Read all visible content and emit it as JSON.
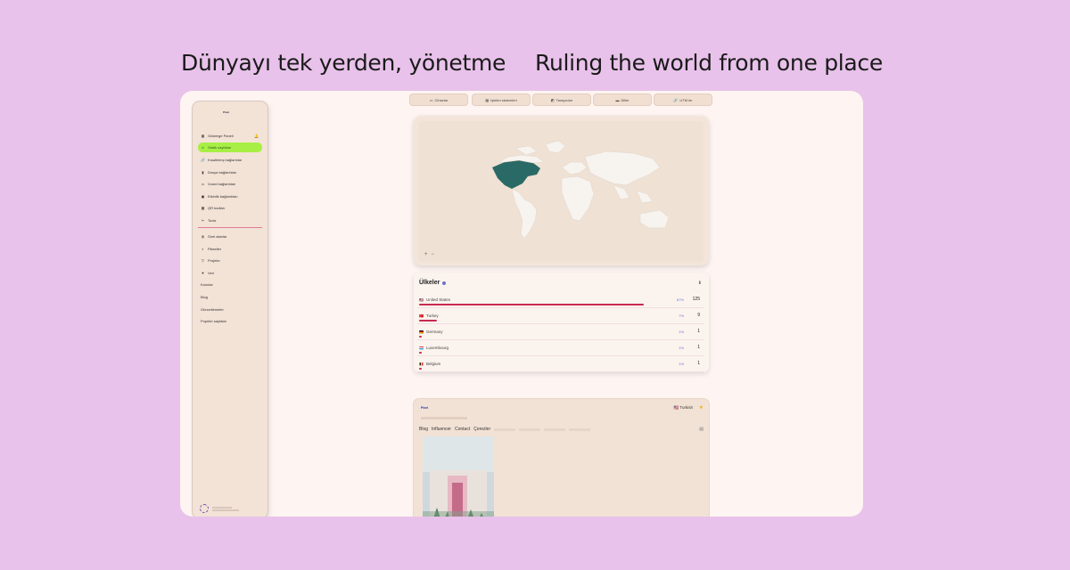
{
  "headlines": {
    "left": "Dünyayı tek yerden, yönetme",
    "right": "Ruling the world from one place"
  },
  "sidebar": {
    "logo": "Pixel",
    "items": [
      {
        "label": "Gösterge Paneli",
        "icon": "dashboard-icon"
      },
      {
        "label": "Statik sayfaları",
        "icon": "hash-icon",
        "active": true
      },
      {
        "label": "Kısaltılmış bağlantılar",
        "icon": "link-icon"
      },
      {
        "label": "Dosya bağlantıları",
        "icon": "file-icon"
      },
      {
        "label": "Vcard bağlantıları",
        "icon": "vcard-icon"
      },
      {
        "label": "Etkinlik bağlantıları",
        "icon": "calendar-icon"
      },
      {
        "label": "QR kodları",
        "icon": "qr-icon"
      },
      {
        "label": "Tools",
        "icon": "tools-icon"
      },
      {
        "label": "Özel alanlar",
        "icon": "globe-icon"
      },
      {
        "label": "Pikseller",
        "icon": "adjust-icon"
      },
      {
        "label": "Projeler",
        "icon": "project-icon"
      },
      {
        "label": "Veri",
        "icon": "data-icon"
      },
      {
        "label": "Konular",
        "icon": ""
      },
      {
        "label": "Blog",
        "icon": ""
      },
      {
        "label": "Güncellemeler",
        "icon": ""
      },
      {
        "label": "Popüler sayfalar",
        "icon": ""
      }
    ]
  },
  "tabs": [
    {
      "label": "Cihazlar",
      "icon": "laptop-icon"
    },
    {
      "label": "İşletim sistemleri",
      "icon": "os-icon"
    },
    {
      "label": "Tarayıcılar",
      "icon": "browser-icon"
    },
    {
      "label": "Diller",
      "icon": "language-icon"
    },
    {
      "label": "UTM ler",
      "icon": "link-icon"
    }
  ],
  "countries": {
    "title": "Ülkeler",
    "rows": [
      {
        "name": "United States",
        "flag": "🇺🇸",
        "pct": "87%",
        "count": "125",
        "share": 0.87
      },
      {
        "name": "Turkey",
        "flag": "🇹🇷",
        "pct": "7%",
        "count": "9",
        "share": 0.07
      },
      {
        "name": "Germany",
        "flag": "🇩🇪",
        "pct": "1%",
        "count": "1",
        "share": 0.01
      },
      {
        "name": "Luxembourg",
        "flag": "🇱🇺",
        "pct": "1%",
        "count": "1",
        "share": 0.01
      },
      {
        "name": "Belgium",
        "flag": "🇧🇪",
        "pct": "1%",
        "count": "1",
        "share": 0.01
      }
    ]
  },
  "map": {
    "zoom_in": "+",
    "zoom_out": "−",
    "highlight_color": "#2a6a66",
    "land_color": "#f7f3ef",
    "sea_color": "#efe1d3"
  },
  "preview": {
    "logo": "Pixel",
    "language": "Turkish",
    "nav": [
      "Blog",
      "Influencer",
      "Contact",
      "Çerezler"
    ]
  }
}
